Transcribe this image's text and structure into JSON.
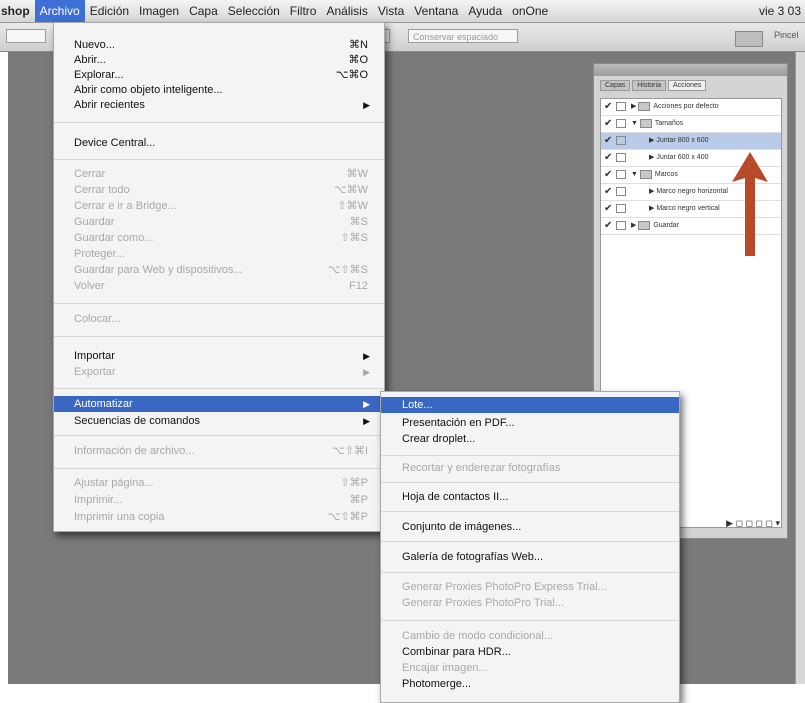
{
  "menubar": {
    "app": "shop",
    "items": [
      "Archivo",
      "Edición",
      "Imagen",
      "Capa",
      "Selección",
      "Filtro",
      "Análisis",
      "Vista",
      "Ventana",
      "Ayuda",
      "onOne"
    ],
    "right": "vie 3 03"
  },
  "options_bar": {
    "field_left": "",
    "field_mid": "",
    "field_right": "Conservar espaciado",
    "right_label": "Pincel"
  },
  "file_menu": {
    "items": [
      {
        "label": "Nuevo...",
        "shortcut": "⌘N",
        "enabled": true
      },
      {
        "label": "Abrir...",
        "shortcut": "⌘O",
        "enabled": true
      },
      {
        "label": "Explorar...",
        "shortcut": "⌥⌘O",
        "enabled": true
      },
      {
        "label": "Abrir como objeto inteligente...",
        "shortcut": "",
        "enabled": true
      },
      {
        "label": "Abrir recientes",
        "shortcut": "",
        "submenu": true,
        "enabled": true
      },
      {
        "label": "Device Central...",
        "shortcut": "",
        "enabled": true
      },
      {
        "label": "Cerrar",
        "shortcut": "⌘W",
        "enabled": false
      },
      {
        "label": "Cerrar todo",
        "shortcut": "⌥⌘W",
        "enabled": false
      },
      {
        "label": "Cerrar e ir a Bridge...",
        "shortcut": "⇧⌘W",
        "enabled": false
      },
      {
        "label": "Guardar",
        "shortcut": "⌘S",
        "enabled": false
      },
      {
        "label": "Guardar como...",
        "shortcut": "⇧⌘S",
        "enabled": false
      },
      {
        "label": "Proteger...",
        "shortcut": "",
        "enabled": false
      },
      {
        "label": "Guardar para Web y dispositivos...",
        "shortcut": "⌥⇧⌘S",
        "enabled": false
      },
      {
        "label": "Volver",
        "shortcut": "F12",
        "enabled": false
      },
      {
        "label": "Colocar...",
        "shortcut": "",
        "enabled": false
      },
      {
        "label": "Importar",
        "shortcut": "",
        "submenu": true,
        "enabled": true
      },
      {
        "label": "Exportar",
        "shortcut": "",
        "submenu": true,
        "enabled": false
      },
      {
        "label": "Automatizar",
        "shortcut": "",
        "submenu": true,
        "enabled": true,
        "highlighted": true
      },
      {
        "label": "Secuencias de comandos",
        "shortcut": "",
        "submenu": true,
        "enabled": true
      },
      {
        "label": "Información de archivo...",
        "shortcut": "⌥⇧⌘I",
        "enabled": false
      },
      {
        "label": "Ajustar página...",
        "shortcut": "⇧⌘P",
        "enabled": false
      },
      {
        "label": "Imprimir...",
        "shortcut": "⌘P",
        "enabled": false
      },
      {
        "label": "Imprimir una copia",
        "shortcut": "⌥⇧⌘P",
        "enabled": false
      }
    ]
  },
  "automate_menu": {
    "items": [
      {
        "label": "Lote...",
        "enabled": true,
        "highlighted": true
      },
      {
        "label": "Presentación en PDF...",
        "enabled": true
      },
      {
        "label": "Crear droplet...",
        "enabled": true
      },
      {
        "label": "Recortar y enderezar fotografías",
        "enabled": false
      },
      {
        "label": "Hoja de contactos II...",
        "enabled": true
      },
      {
        "label": "Conjunto de imágenes...",
        "enabled": true
      },
      {
        "label": "Galería de fotografías Web...",
        "enabled": true
      },
      {
        "label": "Generar Proxies PhotoPro Express Trial...",
        "enabled": false
      },
      {
        "label": "Generar Proxies PhotoPro Trial...",
        "enabled": false
      },
      {
        "label": "Cambio de modo condicional...",
        "enabled": false
      },
      {
        "label": "Combinar para HDR...",
        "enabled": true
      },
      {
        "label": "Encajar imagen...",
        "enabled": false
      },
      {
        "label": "Photomerge...",
        "enabled": true
      }
    ]
  },
  "actions_panel": {
    "tabs": [
      "Capas",
      "Historia",
      "Acciones"
    ],
    "rows": [
      {
        "label": "Acciones por defecto",
        "type": "set"
      },
      {
        "label": "Tamaños",
        "type": "set"
      },
      {
        "label": "Juntar 800 x 600",
        "type": "action",
        "selected": true
      },
      {
        "label": "Juntar 600 x 400",
        "type": "action"
      },
      {
        "label": "Marcos",
        "type": "set"
      },
      {
        "label": "Marco negro horizontal",
        "type": "action"
      },
      {
        "label": "Marco negro vertical",
        "type": "action"
      },
      {
        "label": "Guardar",
        "type": "set"
      }
    ],
    "footer": "▶ ◻ ◻ ◻ ◻ ▾"
  },
  "colors": {
    "menu_highlight": "#3a66c4",
    "workspace": "#7a7a7a",
    "arrow": "#b84a2a"
  }
}
